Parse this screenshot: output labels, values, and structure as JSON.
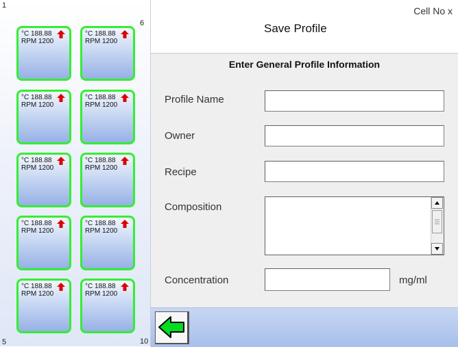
{
  "header": {
    "cell_no": "Cell No  x",
    "title": "Save Profile"
  },
  "grid": {
    "corner_labels": {
      "top_left": "1",
      "top_right": "6",
      "bottom_left": "5",
      "bottom_right": "10"
    },
    "cells": [
      {
        "temp": "°C 188.88",
        "rpm": "RPM 1200"
      },
      {
        "temp": "°C 188.88",
        "rpm": "RPM 1200"
      },
      {
        "temp": "°C 188.88",
        "rpm": "RPM 1200"
      },
      {
        "temp": "°C 188.88",
        "rpm": "RPM 1200"
      },
      {
        "temp": "°C 188.88",
        "rpm": "RPM 1200"
      },
      {
        "temp": "°C 188.88",
        "rpm": "RPM 1200"
      },
      {
        "temp": "°C 188.88",
        "rpm": "RPM 1200"
      },
      {
        "temp": "°C 188.88",
        "rpm": "RPM 1200"
      },
      {
        "temp": "°C 188.88",
        "rpm": "RPM 1200"
      },
      {
        "temp": "°C 188.88",
        "rpm": "RPM 1200"
      }
    ],
    "colors": {
      "cell_border": "#33ee33",
      "arrow": "#dd0000"
    }
  },
  "form": {
    "heading": "Enter General Profile Information",
    "profile_name_label": "Profile Name",
    "profile_name_value": "",
    "owner_label": "Owner",
    "owner_value": "",
    "recipe_label": "Recipe",
    "recipe_value": "",
    "composition_label": "Composition",
    "composition_value": "",
    "concentration_label": "Concentration",
    "concentration_value": "",
    "concentration_unit": "mg/ml"
  },
  "footer": {
    "back_icon": "green-left-arrow-icon"
  }
}
